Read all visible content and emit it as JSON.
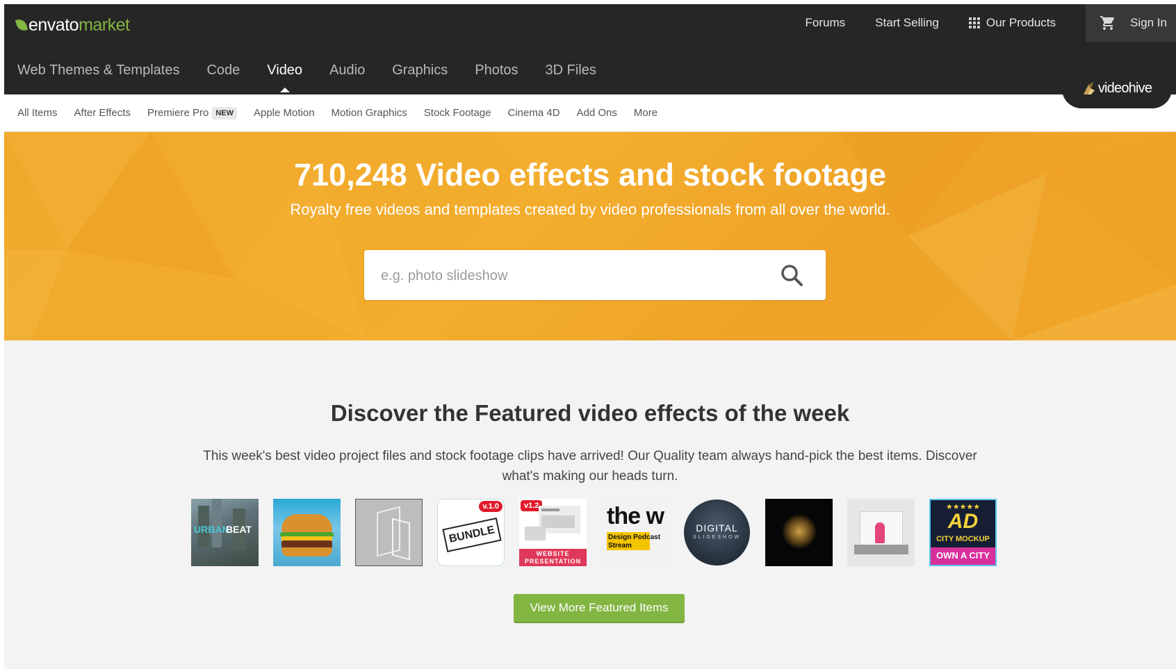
{
  "brand": {
    "name_primary": "envato",
    "name_secondary": "market",
    "accent_color": "#82b541"
  },
  "topnav": {
    "links": [
      "Forums",
      "Start Selling"
    ],
    "products_label": "Our Products",
    "signin_label": "Sign In"
  },
  "categories": [
    {
      "label": "Web Themes & Templates",
      "active": false
    },
    {
      "label": "Code",
      "active": false
    },
    {
      "label": "Video",
      "active": true
    },
    {
      "label": "Audio",
      "active": false
    },
    {
      "label": "Graphics",
      "active": false
    },
    {
      "label": "Photos",
      "active": false
    },
    {
      "label": "3D Files",
      "active": false
    }
  ],
  "site_badge": {
    "label": "videohive"
  },
  "subnav": {
    "items": [
      "All Items",
      "After Effects",
      "Premiere Pro",
      "Apple Motion",
      "Motion Graphics",
      "Stock Footage",
      "Cinema 4D",
      "Add Ons",
      "More"
    ],
    "new_badge": "NEW"
  },
  "hero": {
    "title": "710,248 Video effects and stock footage",
    "subtitle": "Royalty free videos and templates created by video professionals from all over the world.",
    "search_placeholder": "e.g. photo slideshow",
    "background_color": "#f0a82a"
  },
  "featured": {
    "title": "Discover the Featured video effects of the week",
    "description": "This week's best video project files and stock footage clips have arrived! Our Quality team always hand-pick the best items. Discover what's making our heads turn.",
    "thumbs": [
      {
        "text": [
          "URBAN",
          "BEAT"
        ]
      },
      {
        "text": []
      },
      {
        "text": []
      },
      {
        "text": [
          "BUNDLE",
          "v.1.0"
        ]
      },
      {
        "text": [
          "v1.2",
          "WEBSITE",
          "PRESENTATION"
        ]
      },
      {
        "text": [
          "the w",
          "Design Podcast",
          "Stream"
        ]
      },
      {
        "text": [
          "DIGITAL",
          "SLIDESHOW"
        ]
      },
      {
        "text": []
      },
      {
        "text": []
      },
      {
        "text": [
          "AD",
          "CITY MOCKUP",
          "OWN A CITY"
        ]
      }
    ],
    "button_label": "View More Featured Items"
  }
}
